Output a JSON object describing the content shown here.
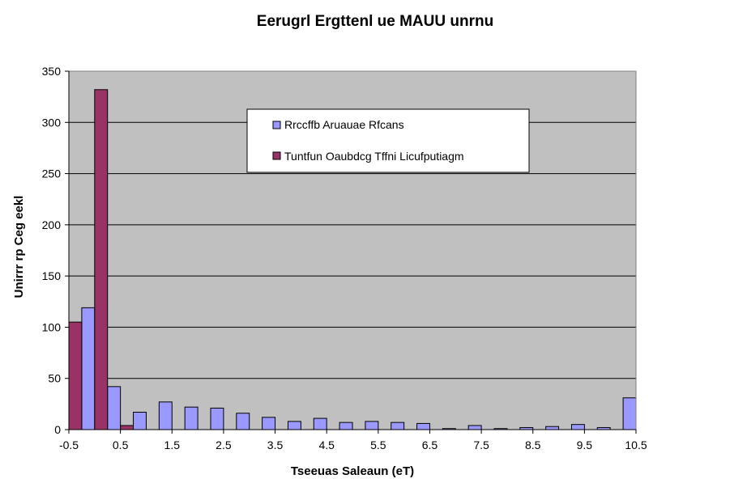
{
  "chart_data": {
    "type": "bar",
    "title": "Eerugrl Ergttenl ue MAUU unrnu",
    "xlabel": "Tseeuas Saleaun (eT)",
    "ylabel": "Unirrr rp Ceg eekl",
    "ylim": [
      0,
      350
    ],
    "yticks": [
      0,
      50,
      100,
      150,
      200,
      250,
      300,
      350
    ],
    "xlim": [
      -0.5,
      10.5
    ],
    "xticks": [
      "-0.5",
      "0.5",
      "1.5",
      "2.5",
      "3.5",
      "4.5",
      "5.5",
      "6.5",
      "7.5",
      "8.5",
      "9.5",
      "10.5"
    ],
    "bin_width": 0.5,
    "grid": true,
    "legend": "top-center",
    "series": [
      {
        "name": "Rrccffb Aruauae Rfcans",
        "color": "#9999FF",
        "bins": [
          -0.5,
          0.0,
          0.5,
          1.0,
          1.5,
          2.0,
          2.5,
          3.0,
          3.5,
          4.0,
          4.5,
          5.0,
          5.5,
          6.0,
          6.5,
          7.0,
          7.5,
          8.0,
          8.5,
          9.0,
          9.5,
          10.0
        ],
        "values": [
          119,
          42,
          17,
          27,
          22,
          21,
          16,
          12,
          8,
          11,
          7,
          8,
          7,
          6,
          1,
          4,
          1,
          2,
          3,
          5,
          2,
          31
        ]
      },
      {
        "name": "Tuntfun Oaubdcg Tffni Licufputiagm",
        "color": "#993366",
        "bins": [
          -0.5,
          0.0,
          0.5
        ],
        "values": [
          105,
          332,
          4
        ]
      }
    ]
  }
}
